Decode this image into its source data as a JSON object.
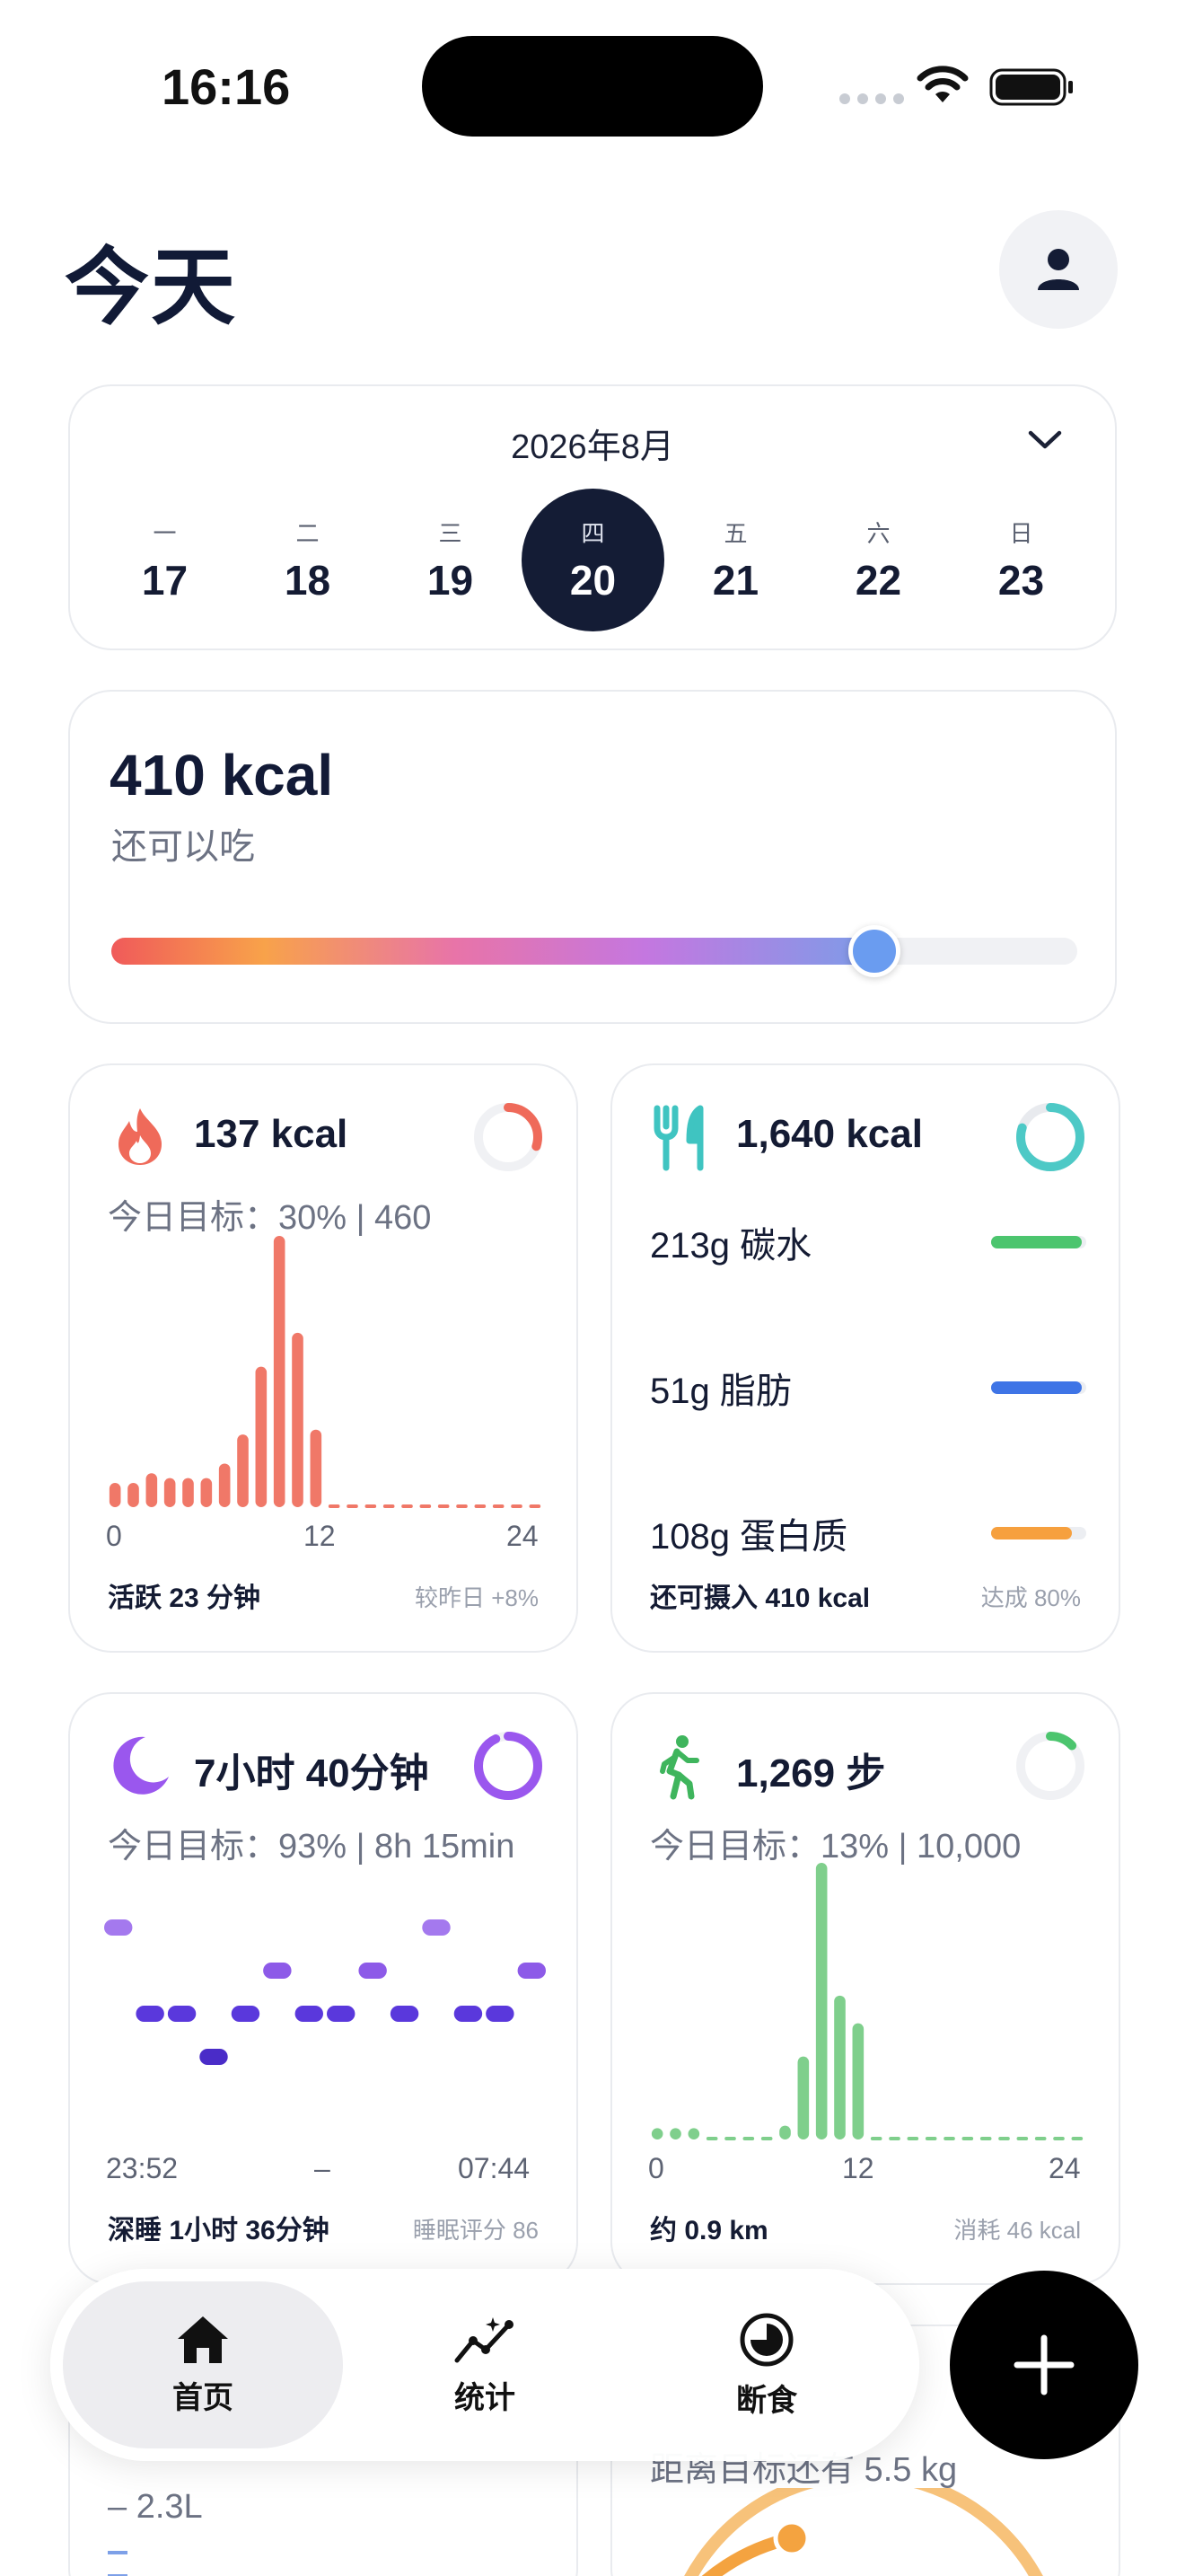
{
  "status_bar": {
    "time": "16:16"
  },
  "header": {
    "title": "今天"
  },
  "calendar": {
    "month": "2026年8月",
    "days": [
      {
        "weekday": "一",
        "day": "17"
      },
      {
        "weekday": "二",
        "day": "18"
      },
      {
        "weekday": "三",
        "day": "19"
      },
      {
        "weekday": "四",
        "day": "20"
      },
      {
        "weekday": "五",
        "day": "21"
      },
      {
        "weekday": "六",
        "day": "22"
      },
      {
        "weekday": "日",
        "day": "23"
      }
    ],
    "selected_index": 3
  },
  "remaining": {
    "value": "410 kcal",
    "label": "还可以吃",
    "progress": 0.79
  },
  "burned": {
    "value": "137 kcal",
    "goal": "今日目标：30% | 460",
    "ring_progress": 0.3,
    "axis": [
      "0",
      "12",
      "24"
    ],
    "hourly_values": [
      5,
      5,
      7,
      6,
      6,
      6,
      9,
      15,
      29,
      56,
      36,
      16,
      0,
      0,
      0,
      0,
      0,
      0,
      0,
      0,
      0,
      0,
      0,
      0
    ],
    "foot_left": "活跃 23 分钟",
    "foot_right": "较昨日 +8%",
    "color": "#f07868"
  },
  "food": {
    "value": "1,640 kcal",
    "ring_progress": 0.8,
    "macros": [
      {
        "label": "213g 碳水",
        "progress": 0.95,
        "color": "#4cc56e"
      },
      {
        "label": "51g 脂肪",
        "progress": 0.95,
        "color": "#3e74e6"
      },
      {
        "label": "108g 蛋白质",
        "progress": 0.85,
        "color": "#f6a03e"
      }
    ],
    "foot_left": "还可摄入 410 kcal",
    "foot_right": "达成 80%"
  },
  "sleep": {
    "value": "7小时 40分钟",
    "goal": "今日目标：93% | 8h 15min",
    "ring_progress": 0.93,
    "stages": [
      1,
      3,
      3,
      4,
      3,
      2,
      3,
      3,
      2,
      3,
      1,
      3,
      3,
      2
    ],
    "axis_start": "23:52",
    "axis_mid": "–",
    "axis_end": "07:44",
    "foot_left": "深睡 1小时 36分钟",
    "foot_right": "睡眠评分 86"
  },
  "steps": {
    "value": "1,269 步",
    "goal": "今日目标：13% | 10,000",
    "ring_progress": 0.13,
    "axis": [
      "0",
      "12",
      "24"
    ],
    "hourly_values": [
      4,
      4,
      4,
      0,
      0,
      0,
      0,
      5,
      30,
      100,
      52,
      42,
      0,
      0,
      0,
      0,
      0,
      0,
      0,
      0,
      0,
      0,
      0,
      0
    ],
    "foot_left": "约 0.9 km",
    "foot_right": "消耗 46 kcal",
    "color": "#7fcf8c"
  },
  "water": {
    "text": "– 2.3L"
  },
  "weight": {
    "text": "距离目标还有 5.5 kg"
  },
  "nav": {
    "home": "首页",
    "stats": "统计",
    "fasting": "断食"
  }
}
